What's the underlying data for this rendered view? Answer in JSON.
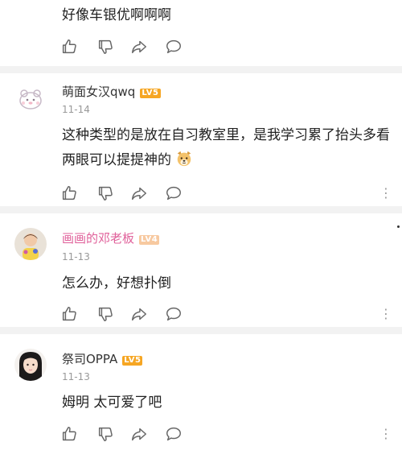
{
  "comments": [
    {
      "content": "好像车银优啊啊啊"
    },
    {
      "username": "萌面女汉qwq",
      "level": "LV5",
      "time": "11-14",
      "content": "这种类型的是放在自习教室里，是我学习累了抬头多看两眼可以提提神的",
      "emoji": "dog-face-emoji"
    },
    {
      "username": "画画的邓老板",
      "level": "LV4",
      "time": "11-13",
      "content": "怎么办，好想扑倒"
    },
    {
      "username": "祭司OPPA",
      "level": "LV5",
      "time": "11-13",
      "content": "姆明 太可爱了吧"
    }
  ],
  "icons": {
    "like": "thumbs-up-icon",
    "dislike": "thumbs-down-icon",
    "share": "share-icon",
    "reply": "comment-icon",
    "more": "more-options-icon"
  },
  "colors": {
    "level_badge": "#f6a623",
    "level_badge_lv4": "#f7c9a0",
    "highlighted_name": "#e0609a",
    "divider": "#f2f2f2",
    "meta_text": "#999999"
  }
}
